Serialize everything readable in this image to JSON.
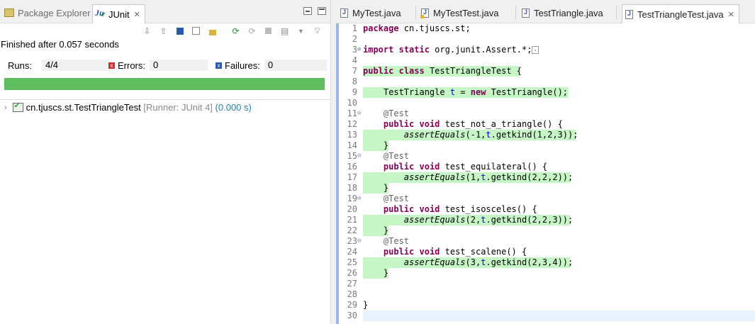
{
  "left_panel": {
    "tabs": [
      {
        "label": "Package Explorer",
        "active": false
      },
      {
        "label": "JUnit",
        "active": true
      }
    ],
    "status": "Finished after 0.057 seconds",
    "counters": {
      "runs_label": "Runs:",
      "runs_value": "4/4",
      "errors_label": "Errors:",
      "errors_value": "0",
      "failures_label": "Failures:",
      "failures_value": "0"
    },
    "progress_fraction": 1.0,
    "progress_color": "#5fbd60",
    "tree": {
      "name": "cn.tjuscs.st.TestTriangleTest",
      "runner": "[Runner: JUnit 4]",
      "time": "(0.000 s)"
    }
  },
  "editor": {
    "tabs": [
      {
        "label": "MyTest.java",
        "active": false
      },
      {
        "label": "MyTestTest.java",
        "active": false
      },
      {
        "label": "TestTriangle.java",
        "active": false
      },
      {
        "label": "TestTriangleTest.java",
        "active": true
      }
    ],
    "lines": [
      {
        "n": "1",
        "html": "<span class='kw'>package</span> cn.tjuscs.st;"
      },
      {
        "n": "2",
        "html": ""
      },
      {
        "n": "3",
        "fold": "+",
        "html": "<span class='kw'>import</span> <span class='kw'>static</span> org.junit.Assert.*;<span class='boxdots'>.</span>"
      },
      {
        "n": "4",
        "html": ""
      },
      {
        "n": "7",
        "hl": 220,
        "html": "<span class='kw'>public</span> <span class='kw'>class</span> TestTriangleTest {"
      },
      {
        "n": "8",
        "html": ""
      },
      {
        "n": "9",
        "hl": 290,
        "html": "    TestTriangle <span class='fd'>t</span> = <span class='kw'>new</span> TestTriangle();"
      },
      {
        "n": "10",
        "html": ""
      },
      {
        "n": "11",
        "fold": "-",
        "html": "    <span class='an'>@Test</span>"
      },
      {
        "n": "12",
        "html": "    <span class='kw'>public</span> <span class='kw'>void</span> test_not_a_triangle() {"
      },
      {
        "n": "13",
        "hl": 300,
        "html": "        <span class='st'>assertEquals</span>(-1,<span class='fd'>t</span>.getkind(1,2,3));"
      },
      {
        "n": "14",
        "hl": 36,
        "html": "    }"
      },
      {
        "n": "15",
        "fold": "-",
        "html": "    <span class='an'>@Test</span>"
      },
      {
        "n": "16",
        "html": "    <span class='kw'>public</span> <span class='kw'>void</span> test_equilateral() {"
      },
      {
        "n": "17",
        "hl": 292,
        "html": "        <span class='st'>assertEquals</span>(1,<span class='fd'>t</span>.getkind(2,2,2));"
      },
      {
        "n": "18",
        "hl": 36,
        "html": "    }"
      },
      {
        "n": "19",
        "fold": "-",
        "html": "    <span class='an'>@Test</span>"
      },
      {
        "n": "20",
        "html": "    <span class='kw'>public</span> <span class='kw'>void</span> test_isosceles() {"
      },
      {
        "n": "21",
        "hl": 292,
        "html": "        <span class='st'>assertEquals</span>(2,<span class='fd'>t</span>.getkind(2,2,3));"
      },
      {
        "n": "22",
        "hl": 36,
        "html": "    }"
      },
      {
        "n": "23",
        "fold": "-",
        "html": "    <span class='an'>@Test</span>"
      },
      {
        "n": "24",
        "html": "    <span class='kw'>public</span> <span class='kw'>void</span> test_scalene() {"
      },
      {
        "n": "25",
        "hl": 292,
        "html": "        <span class='st'>assertEquals</span>(3,<span class='fd'>t</span>.getkind(2,3,4));"
      },
      {
        "n": "26",
        "hl": 36,
        "html": "    }"
      },
      {
        "n": "27",
        "html": ""
      },
      {
        "n": "28",
        "html": ""
      },
      {
        "n": "29",
        "html": "}"
      },
      {
        "n": "30",
        "current": true,
        "html": ""
      }
    ]
  }
}
